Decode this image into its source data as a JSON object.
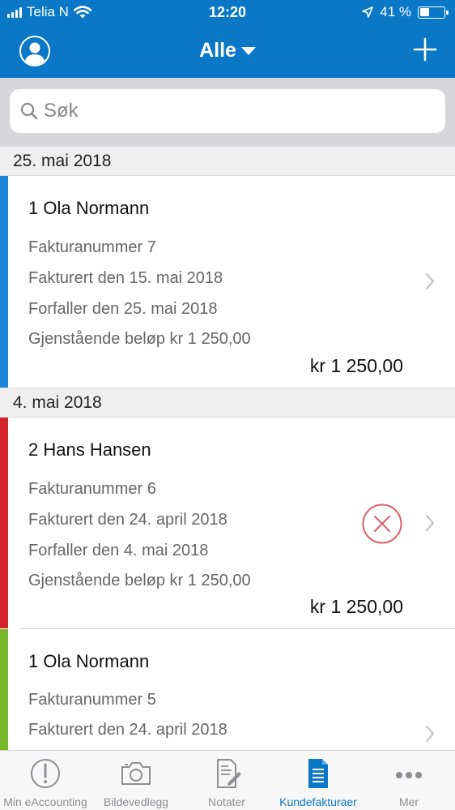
{
  "status_bar": {
    "carrier": "Telia N",
    "time": "12:20",
    "battery": "41 %",
    "battery_level": 0.41
  },
  "nav": {
    "title": "Alle",
    "avatar_icon": "user-avatar-icon",
    "add_icon": "plus-icon"
  },
  "search": {
    "placeholder": "Søk",
    "value": ""
  },
  "sections": [
    {
      "date": "25. mai 2018",
      "invoices": [
        {
          "status_color": "#1a87d8",
          "customer": "1 Ola Normann",
          "number": "Fakturanummer 7",
          "invoiced": "Fakturert den 15. mai 2018",
          "due": "Forfaller den 25. mai 2018",
          "remaining": "Gjenstående beløp kr 1 250,00",
          "amount": "kr 1 250,00"
        }
      ]
    },
    {
      "date": "4. mai 2018",
      "invoices": [
        {
          "status_color": "#d4242b",
          "customer": "2 Hans Hansen",
          "number": "Fakturanummer 6",
          "invoiced": "Fakturert den 24. april 2018",
          "due": "Forfaller den 4. mai 2018",
          "remaining": "Gjenstående beløp kr 1 250,00",
          "amount": "kr 1 250,00",
          "flag_icon": "cancelled-x-circle-icon"
        },
        {
          "status_color": "#77b72a",
          "customer": "1 Ola Normann",
          "number": "Fakturanummer 5",
          "invoiced": "Fakturert den 24. april 2018"
        }
      ]
    }
  ],
  "tabbar": {
    "accent": "#0a78c6",
    "tabs": [
      {
        "label": "Min eAccounting",
        "icon": "alert-circle-icon",
        "active": false
      },
      {
        "label": "Bildevedlegg",
        "icon": "camera-icon",
        "active": false
      },
      {
        "label": "Notater",
        "icon": "note-pen-icon",
        "active": false
      },
      {
        "label": "Kundefakturaer",
        "icon": "invoice-document-icon",
        "active": true
      },
      {
        "label": "Mer",
        "icon": "more-dots-icon",
        "active": false
      }
    ]
  }
}
